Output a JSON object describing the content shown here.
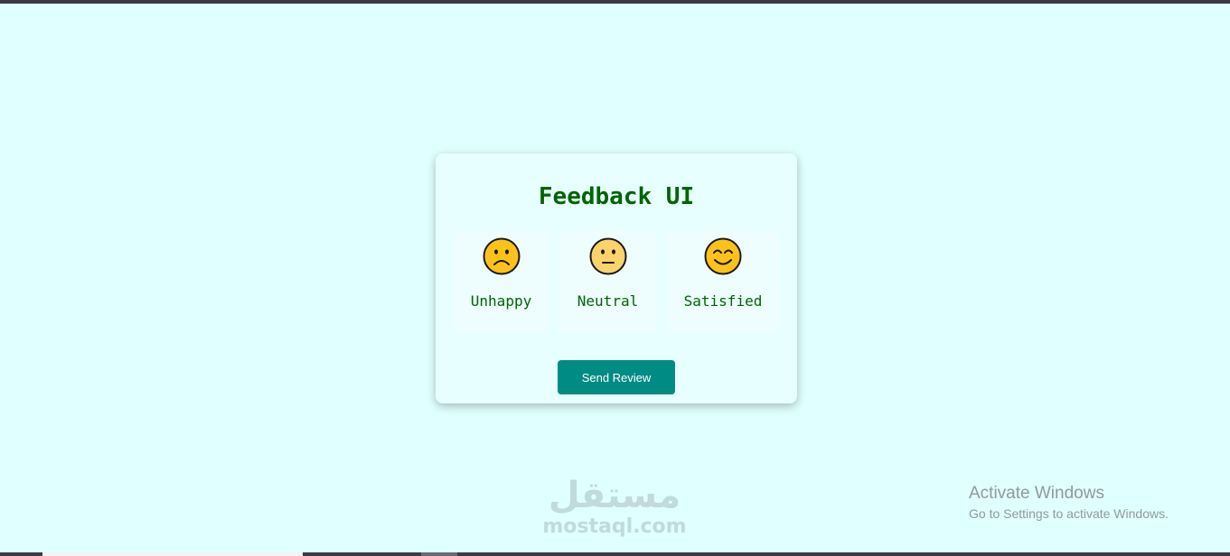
{
  "app": {
    "title": "Feedback UI"
  },
  "ratings": [
    {
      "label": "Unhappy",
      "icon": "sad-face-icon",
      "face_color": "#fcc21b"
    },
    {
      "label": "Neutral",
      "icon": "neutral-face-icon",
      "face_color": "#fcd36b"
    },
    {
      "label": "Satisfied",
      "icon": "smiling-face-icon",
      "face_color": "#fcc21b"
    }
  ],
  "actions": {
    "send_label": "Send Review"
  },
  "watermark": {
    "arabic": "مستقل",
    "latin": "mostaql.com"
  },
  "os_notice": {
    "title": "Activate Windows",
    "subtitle": "Go to Settings to activate Windows."
  },
  "colors": {
    "page_background": "#e0ffff",
    "title_color": "#006400",
    "button_color": "#008b84"
  }
}
